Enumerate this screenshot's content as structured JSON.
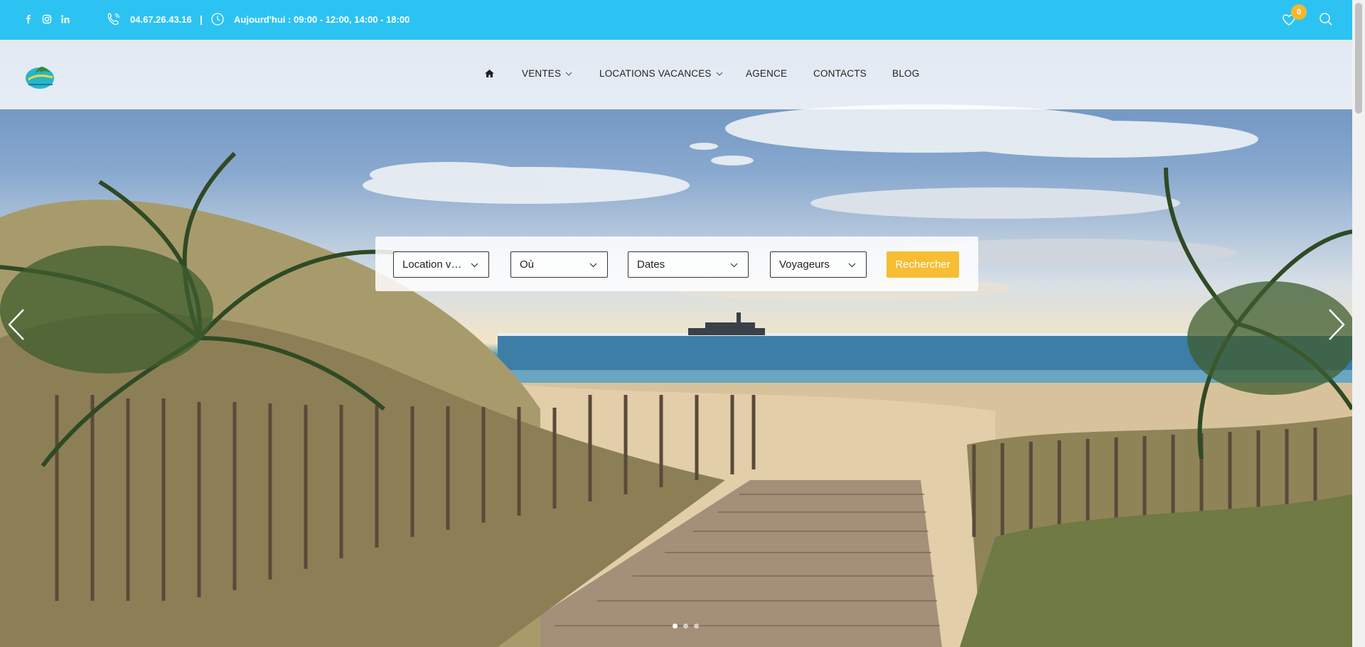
{
  "topbar": {
    "social": [
      "facebook-icon",
      "instagram-icon",
      "linkedin-icon"
    ],
    "phone": "04.67.26.43.16",
    "separator": "|",
    "hours": "Aujourd'hui : 09:00 - 12:00, 14:00 - 18:00",
    "wishlist_count": "0",
    "color": "#2cc3f3",
    "badge_color": "#f5b82e"
  },
  "nav": {
    "home_icon": "home-icon",
    "items": [
      {
        "label": "VENTES",
        "dropdown": true
      },
      {
        "label": "LOCATIONS VACANCES",
        "dropdown": true
      },
      {
        "label": "AGENCE",
        "dropdown": false
      },
      {
        "label": "CONTACTS",
        "dropdown": false
      },
      {
        "label": "BLOG",
        "dropdown": false
      }
    ]
  },
  "search": {
    "type": "Location vacances",
    "where": "Où",
    "dates": "Dates",
    "guests": "Voyageurs",
    "button": "Rechercher",
    "button_color": "#f7bd33"
  },
  "slider": {
    "slides": 3,
    "active": 1,
    "prev_icon": "chevron-left-icon",
    "next_icon": "chevron-right-icon"
  }
}
